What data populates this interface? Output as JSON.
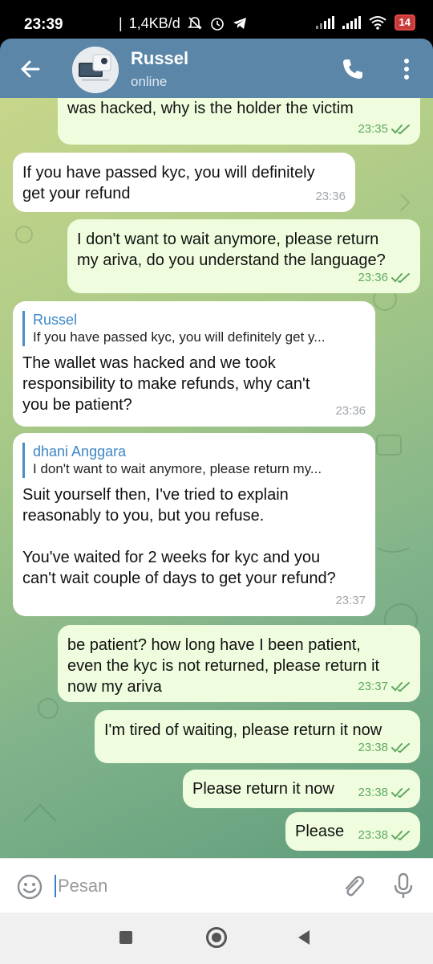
{
  "status_bar": {
    "time": "23:39",
    "net_speed": "1,4KB/d",
    "battery": "14"
  },
  "header": {
    "title": "Russel",
    "subtitle": "online",
    "accent": "#5b86a8"
  },
  "messages": [
    {
      "dir": "out",
      "text": "was hacked, why is the holder the victim",
      "time": "23:35",
      "read": true
    },
    {
      "dir": "in",
      "text": "If you have passed kyc, you will definitely\nget your refund",
      "time": "23:36"
    },
    {
      "dir": "out",
      "text": "I don't want to wait anymore, please return\nmy ariva, do you understand the language?",
      "time": "23:36",
      "read": true
    },
    {
      "dir": "in",
      "reply_name": "Russel",
      "reply_text": "If you have passed kyc, you will definitely get y...",
      "text": "The wallet was hacked and we took\nresponsibility to make refunds, why can't\nyou be patient?",
      "time": "23:36"
    },
    {
      "dir": "in",
      "reply_name": "dhani Anggara",
      "reply_text": "I don't want to wait anymore, please return my...",
      "text": "Suit yourself then, I've tried to explain\nreasonably to you, but you refuse.\n\nYou've waited for 2 weeks for kyc and you\ncan't wait couple of days to get your refund?",
      "time": "23:37"
    },
    {
      "dir": "out",
      "text": "be patient? how long have I been patient,\neven the kyc is not returned, please return it\nnow my ariva",
      "time": "23:37",
      "read": true
    },
    {
      "dir": "out",
      "text": "I'm tired of waiting, please return it now",
      "time": "23:38",
      "read": true
    },
    {
      "dir": "out",
      "text": "Please return it now",
      "time": "23:38",
      "read": true
    },
    {
      "dir": "out",
      "text": "Please",
      "time": "23:38",
      "read": true
    }
  ],
  "composer": {
    "placeholder": "Pesan"
  },
  "colors": {
    "incoming_bubble": "#ffffff",
    "outgoing_bubble": "#effdde",
    "outgoing_meta": "#5fa962",
    "reply_accent": "#3d86c6"
  }
}
